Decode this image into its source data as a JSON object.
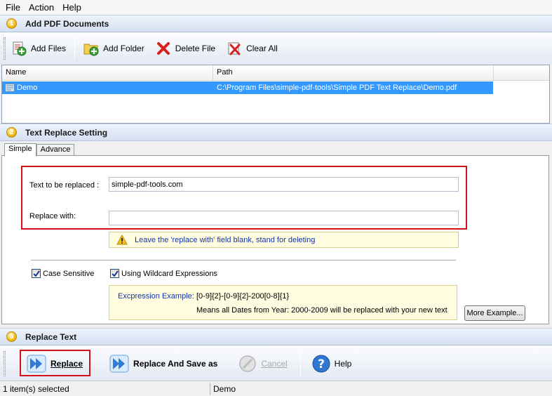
{
  "menu": [
    "File",
    "Action",
    "Help"
  ],
  "section1": {
    "number": "1",
    "title": "Add PDF Documents"
  },
  "toolbar1": {
    "add_files": "Add Files",
    "add_folder": "Add Folder",
    "delete_file": "Delete File",
    "clear_all": "Clear All"
  },
  "filelist": {
    "columns": [
      "Name",
      "Path"
    ],
    "rows": [
      {
        "name": "Demo",
        "path": "C:\\Program Files\\simple-pdf-tools\\Simple PDF Text Replace\\Demo.pdf"
      }
    ]
  },
  "section2": {
    "number": "2",
    "title": "Text Replace Setting"
  },
  "tabs": [
    "Simple",
    "Advance"
  ],
  "form": {
    "text_label": "Text to be replaced :",
    "text_value": "simple-pdf-tools.com",
    "replace_label": "Replace with:",
    "replace_value": "",
    "warning": "Leave the 'replace with' field blank, stand for deleting",
    "case_sensitive": "Case Sensitive",
    "wildcard": "Using Wildcard Expressions",
    "example_label": "Excpression Example:",
    "example_pattern": "[0-9]{2}-[0-9]{2}-200[0-8]{1}",
    "example_desc": "Means all Dates from Year: 2000-2009 will be replaced with your new text",
    "more_example": "More Example..."
  },
  "section3": {
    "number": "3",
    "title": "Replace Text"
  },
  "toolbar3": {
    "replace": "Replace",
    "replace_save": "Replace And Save as",
    "cancel": "Cancel",
    "help": "Help"
  },
  "status": {
    "selected": "1 item(s) selected",
    "current": "Demo"
  },
  "colors": {
    "selection": "#3399ff",
    "highlight_red": "#d0131b",
    "link_blue": "#1535a8"
  }
}
